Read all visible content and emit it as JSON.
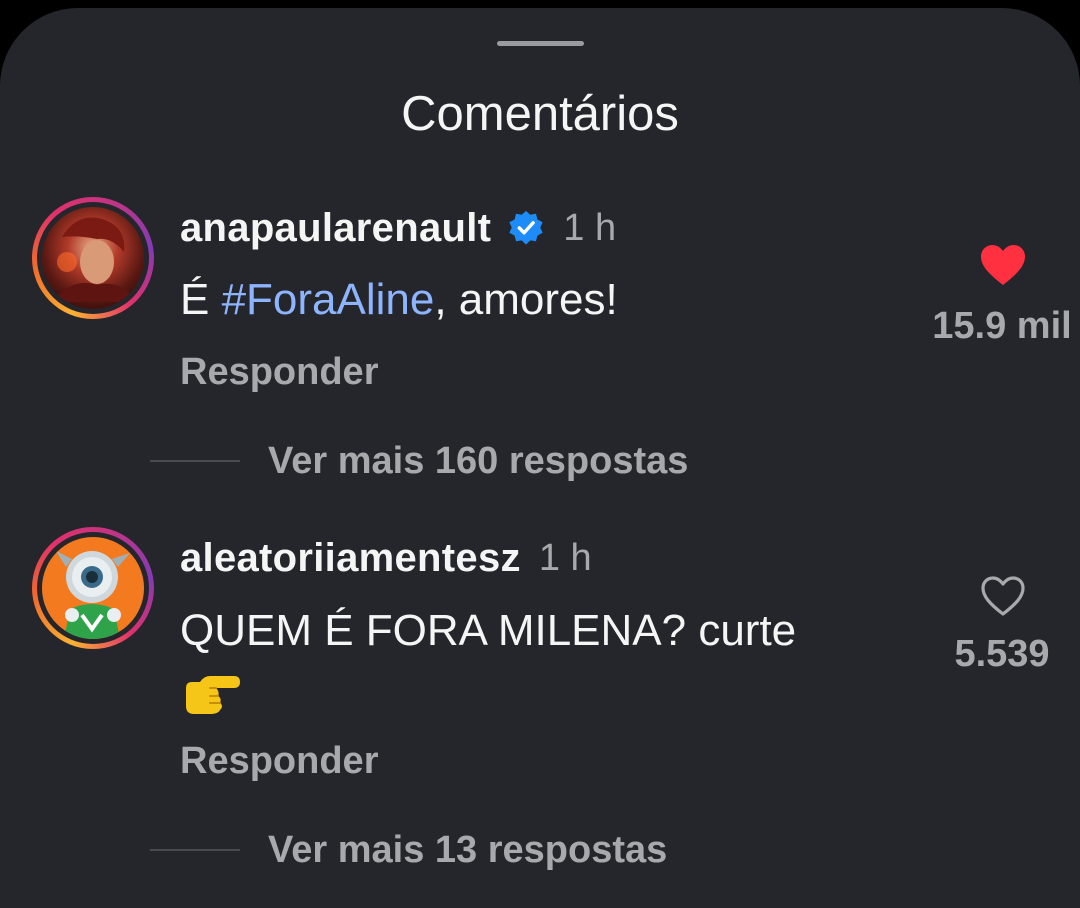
{
  "sheet": {
    "title": "Comentários"
  },
  "colors": {
    "background": "#25262b",
    "hashtag": "#8db4ff",
    "heart_liked": "#ff3040",
    "verified": "#1d8cf8",
    "muted_text": "#a8a9ad"
  },
  "comments": [
    {
      "username": "anapaularenault",
      "verified": true,
      "time": "1 h",
      "text_prefix": "É ",
      "hashtag": "#ForaAline",
      "text_suffix": ", amores!",
      "reply_label": "Responder",
      "view_replies": "Ver mais 160 respostas",
      "likes": "15.9 mil",
      "liked": true,
      "like_icon": "heart-filled-icon"
    },
    {
      "username": "aleatoriiamentesz",
      "verified": false,
      "time": "1 h",
      "text": "QUEM É FORA MILENA? curte",
      "emoji": "pointing-right-hand-emoji",
      "reply_label": "Responder",
      "view_replies": "Ver mais 13 respostas",
      "likes": "5.539",
      "liked": false,
      "like_icon": "heart-outline-icon"
    }
  ]
}
